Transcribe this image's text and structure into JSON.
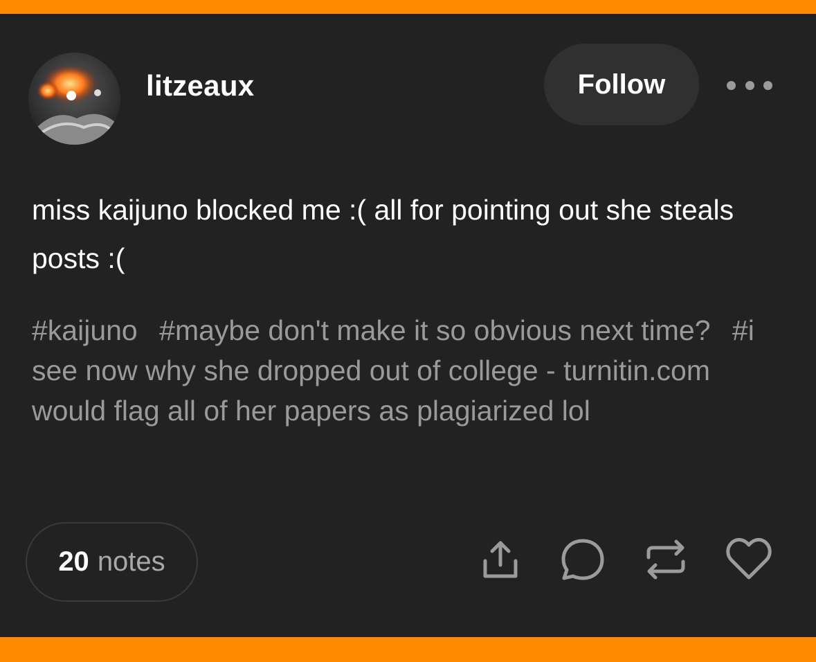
{
  "post": {
    "username": "litzeaux",
    "follow_label": "Follow",
    "text": "miss kaijuno blocked me :( all for pointing out she steals posts :(",
    "tags": [
      "#kaijuno",
      "#maybe don't make it so obvious next time?",
      "#i see now why she dropped out of college - turnitin.com would flag all of her papers as plagiarized lol"
    ],
    "notes_count": "20",
    "notes_label": "notes"
  },
  "icons": {
    "more": "more-options-icon",
    "share": "share-icon",
    "reply": "reply-icon",
    "reblog": "reblog-icon",
    "like": "heart-icon"
  },
  "colors": {
    "frame": "#ff8a00",
    "card_bg": "#222222",
    "button_bg": "#303030",
    "tag_text": "#9a9a9a",
    "icon": "#9b9b9b"
  }
}
